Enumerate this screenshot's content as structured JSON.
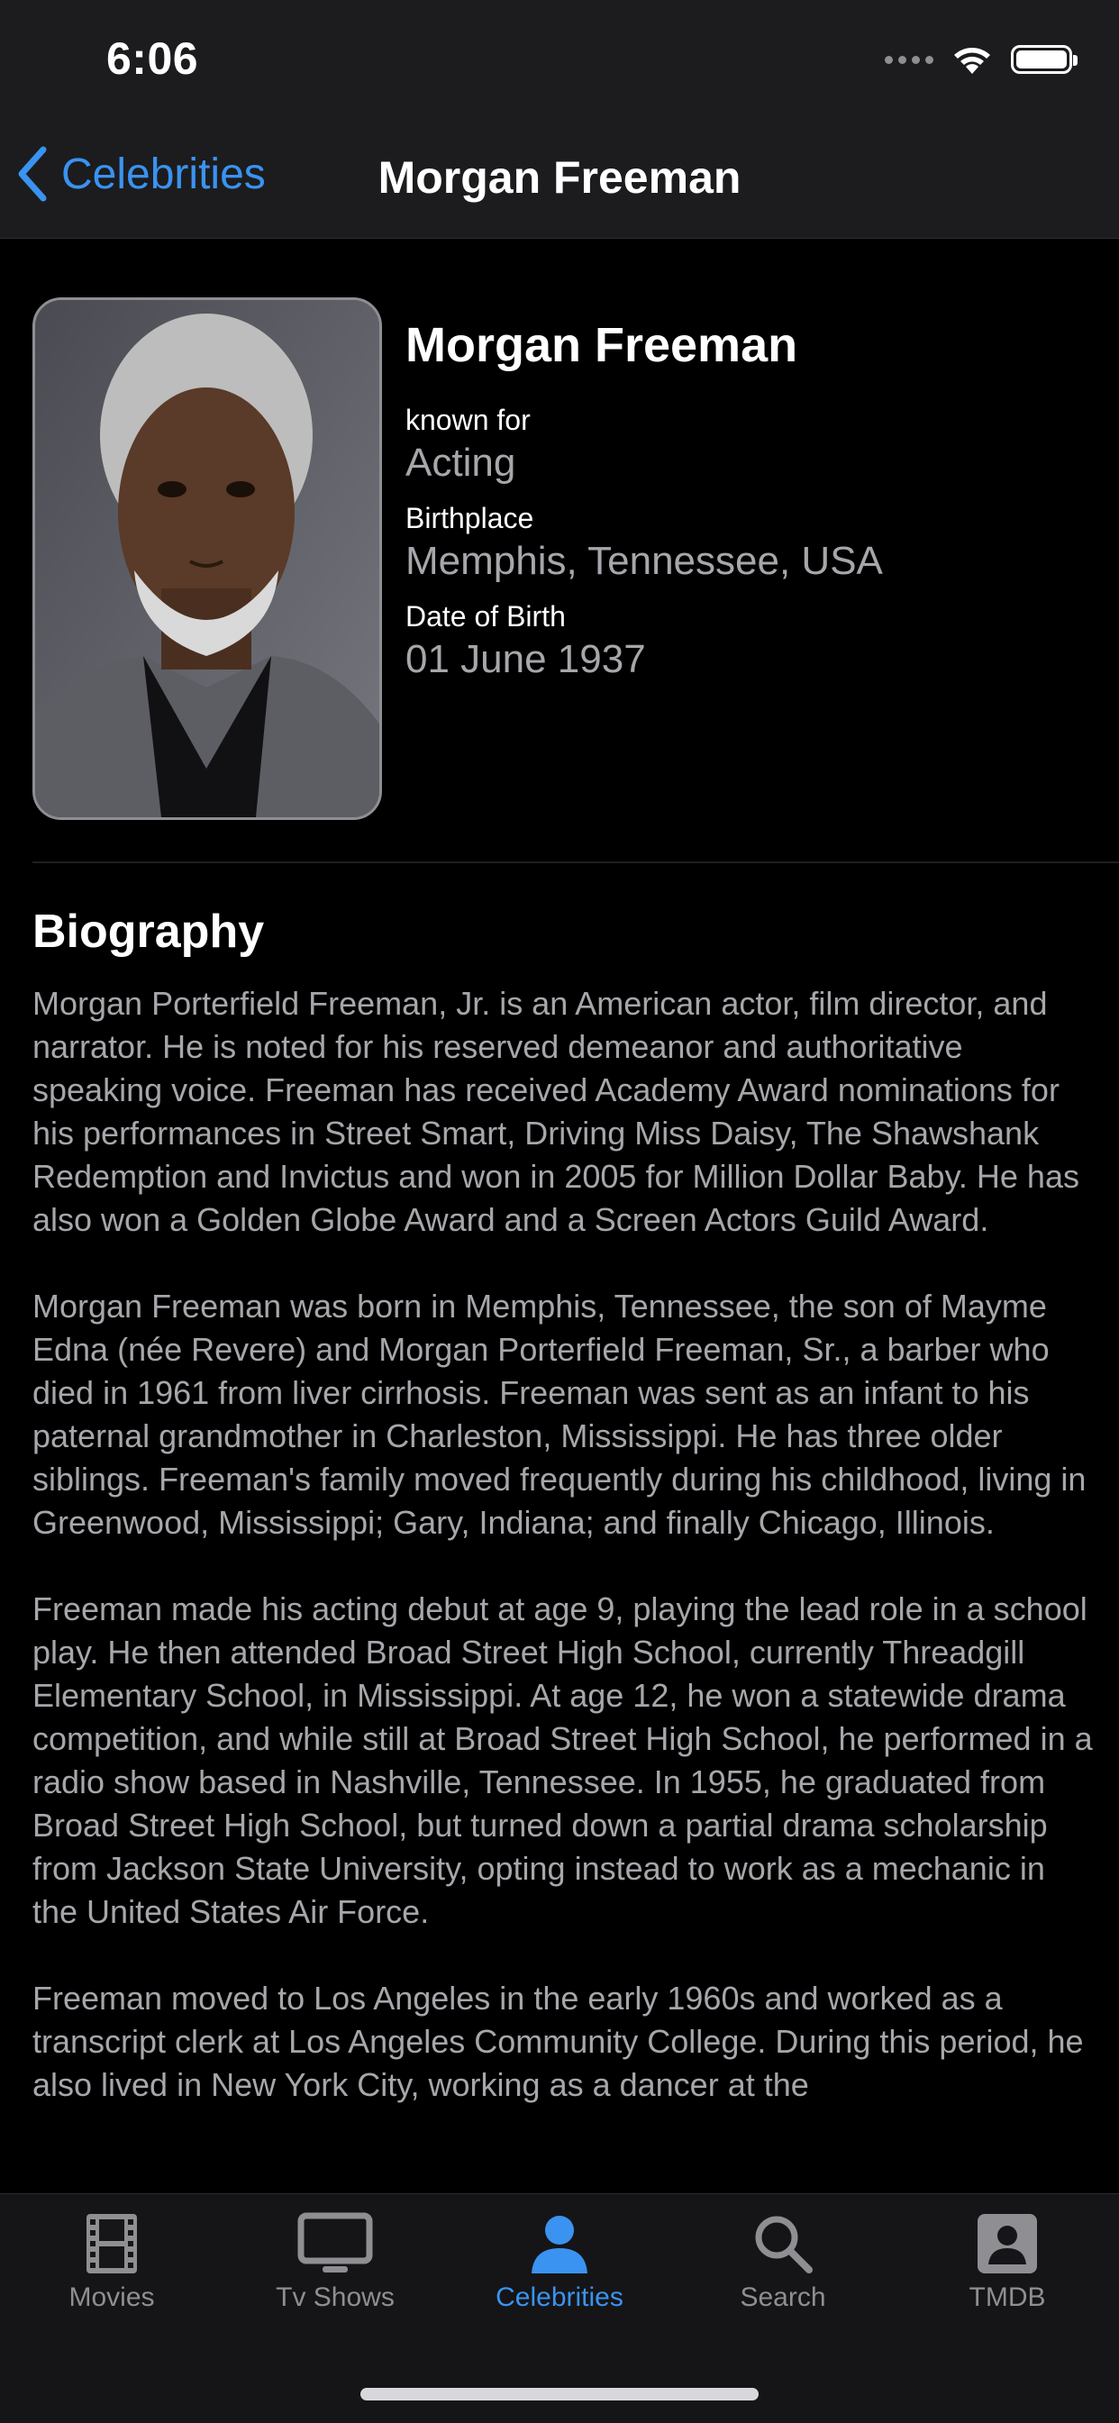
{
  "status_bar": {
    "time": "6:06"
  },
  "nav": {
    "back_label": "Celebrities",
    "title": "Morgan Freeman"
  },
  "profile": {
    "name": "Morgan Freeman",
    "known_for_label": "known for",
    "known_for_value": "Acting",
    "birthplace_label": "Birthplace",
    "birthplace_value": "Memphis, Tennessee, USA",
    "dob_label": "Date of Birth",
    "dob_value": "01 June 1937"
  },
  "biography": {
    "heading": "Biography",
    "paragraphs": [
      "Morgan Porterfield Freeman, Jr. is an American actor, film director, and narrator. He is noted for his reserved demeanor and authoritative speaking voice. Freeman has received Academy Award nominations for his performances in Street Smart, Driving Miss Daisy, The Shawshank Redemption and Invictus and won in 2005 for Million Dollar Baby. He has also won a Golden Globe Award and a Screen Actors Guild Award.",
      "Morgan Freeman was born in Memphis, Tennessee, the son of Mayme Edna (née Revere) and Morgan Porterfield Freeman, Sr., a barber who died in 1961 from liver cirrhosis. Freeman was sent as an infant to his paternal grandmother in Charleston, Mississippi. He has three older siblings. Freeman's family moved frequently during his childhood, living in Greenwood, Mississippi; Gary, Indiana; and finally Chicago, Illinois.",
      "Freeman made his acting debut at age 9, playing the lead role in a school play. He then attended Broad Street High School, currently Threadgill Elementary School, in Mississippi. At age 12, he won a statewide drama competition, and while still at Broad Street High School, he performed in a radio show based in Nashville, Tennessee. In 1955, he graduated from Broad Street High School, but turned down a partial drama scholarship from Jackson State University, opting instead to work as a mechanic in the United States Air Force.",
      "Freeman moved to Los Angeles in the early 1960s and worked as a transcript clerk at Los Angeles Community College. During this period, he also lived in New York City, working as a dancer at the"
    ]
  },
  "tabs": [
    {
      "label": "Movies",
      "icon": "film-icon"
    },
    {
      "label": "Tv Shows",
      "icon": "tv-icon"
    },
    {
      "label": "Celebrities",
      "icon": "person-icon",
      "active": true
    },
    {
      "label": "Search",
      "icon": "magnifier-icon"
    },
    {
      "label": "TMDB",
      "icon": "contact-card-icon"
    }
  ],
  "colors": {
    "accent": "#3a93f0",
    "secondary_text": "#a6a6ab",
    "bar_background": "#1c1c1e"
  }
}
